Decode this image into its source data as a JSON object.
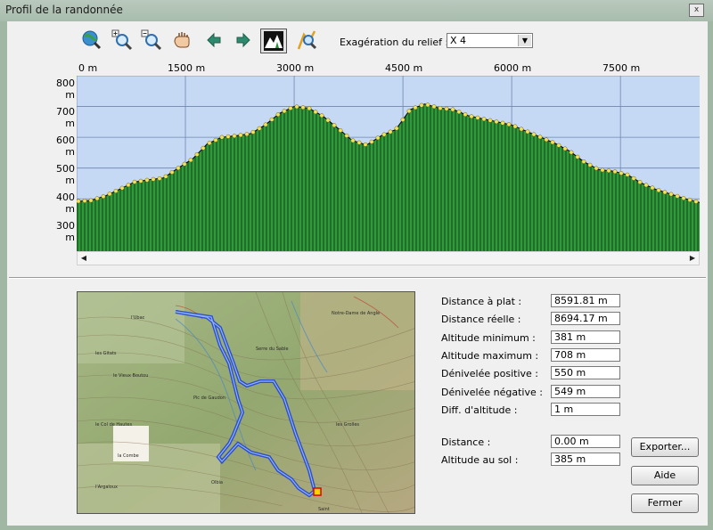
{
  "window": {
    "title": "Profil de la randonnée",
    "close_glyph": "x"
  },
  "toolbar": {
    "buttons": [
      {
        "icon": "globe-zoom-icon"
      },
      {
        "icon": "zoom-in-icon"
      },
      {
        "icon": "zoom-out-icon"
      },
      {
        "icon": "hand-pan-icon"
      },
      {
        "icon": "arrow-left-icon"
      },
      {
        "icon": "arrow-right-icon"
      },
      {
        "icon": "terrain-profile-icon",
        "pressed": true
      },
      {
        "icon": "route-zoom-icon"
      }
    ],
    "relief_label": "Exagération du relief :",
    "relief_value": "X 4"
  },
  "chart_data": {
    "type": "area",
    "x_unit": "m",
    "x_ticks": [
      "0 m",
      "1500 m",
      "3000 m",
      "4500 m",
      "6000 m",
      "7500 m"
    ],
    "y_ticks": [
      "800 m",
      "700 m",
      "600 m",
      "500 m",
      "400 m",
      "300 m"
    ],
    "xlim": [
      0,
      8592
    ],
    "ylim": [
      230,
      800
    ],
    "grid": true,
    "colors": {
      "plot_bg": "#c5d9f5",
      "fill": "#2e9a3a",
      "stroke": "#000000",
      "marker": "#f2e15a",
      "grid": "#6f86b0"
    },
    "x": [
      0,
      200,
      400,
      600,
      800,
      1000,
      1200,
      1400,
      1600,
      1800,
      2000,
      2200,
      2400,
      2600,
      2800,
      3000,
      3200,
      3400,
      3600,
      3800,
      4000,
      4200,
      4400,
      4600,
      4800,
      5000,
      5200,
      5400,
      5600,
      5800,
      6000,
      6200,
      6400,
      6600,
      6800,
      7000,
      7200,
      7400,
      7600,
      7800,
      8000,
      8200,
      8400,
      8592
    ],
    "y": [
      392,
      395,
      410,
      432,
      455,
      462,
      468,
      500,
      530,
      578,
      600,
      605,
      612,
      640,
      678,
      700,
      695,
      668,
      630,
      590,
      575,
      605,
      625,
      690,
      708,
      695,
      690,
      670,
      660,
      650,
      640,
      620,
      600,
      580,
      555,
      520,
      495,
      490,
      478,
      450,
      430,
      415,
      400,
      388
    ]
  },
  "stats": [
    {
      "label": "Distance à plat :",
      "value": "8591.81 m"
    },
    {
      "label": "Distance réelle :",
      "value": "8694.17 m"
    },
    {
      "label": "Altitude minimum :",
      "value": "381 m"
    },
    {
      "label": "Altitude maximum :",
      "value": "708 m"
    },
    {
      "label": "Dénivelée positive :",
      "value": "550 m"
    },
    {
      "label": "Dénivelée négative :",
      "value": "549 m"
    },
    {
      "label": "Diff. d'altitude :",
      "value": "1 m"
    }
  ],
  "cursor": [
    {
      "label": "Distance :",
      "value": "0.00 m"
    },
    {
      "label": "Altitude au sol :",
      "value": "385 m"
    }
  ],
  "buttons": {
    "export": "Exporter...",
    "help": "Aide",
    "close": "Fermer"
  },
  "map": {
    "labels": [
      "l'Ubac",
      "les Gitats",
      "le Vieux Boutou",
      "Pic de Gaudon",
      "Serre du Sable",
      "Notre-Dame de Angle",
      "le Col de Hautes",
      "la Combe",
      "Olbia",
      "Saint",
      "l'Argaloux",
      "les Grolles"
    ]
  }
}
